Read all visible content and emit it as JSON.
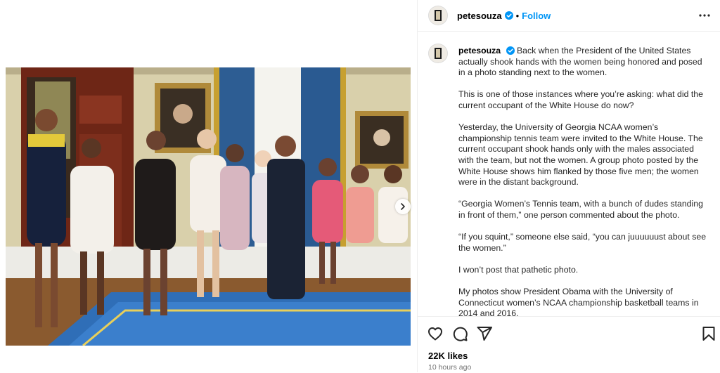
{
  "post": {
    "username": "petesouza",
    "dot": "•",
    "follow_label": "Follow",
    "likes": "22K likes",
    "time": "10 hours ago",
    "caption_username": "petesouza",
    "caption_paragraphs": [
      "Back when the President of the United States actually shook hands with the women being honored and posed in a photo standing next to the women.",
      "This is one of those instances where you’re asking: what did the current occupant of the White House do now?",
      "Yesterday, the University of Georgia NCAA women’s championship tennis team were invited to the White House. The current occupant shook hands only with the males associated with the team, but not the women. A group photo posted by the White House shows him flanked by those five men; the women were in the distant background.",
      "“Georgia Women’s Tennis team, with a bunch of dudes standing in front of them,” one person commented about the photo.",
      "“If you squint,” someone else said, “you can juuuuuust about see the women.”",
      "I won’t post that pathetic photo.",
      "My photos show President Obama with the University of Connecticut women’s NCAA championship basketball teams in 2014 and 2016."
    ]
  },
  "icons": {
    "verified": "verified-badge-icon",
    "more": "more-options-icon",
    "like": "heart-icon",
    "comment": "comment-icon",
    "share": "share-icon",
    "save": "bookmark-icon",
    "next": "chevron-right-icon"
  },
  "colors": {
    "accent": "#0095f6",
    "text": "#262626",
    "muted": "#737373",
    "divider": "#efefef"
  }
}
